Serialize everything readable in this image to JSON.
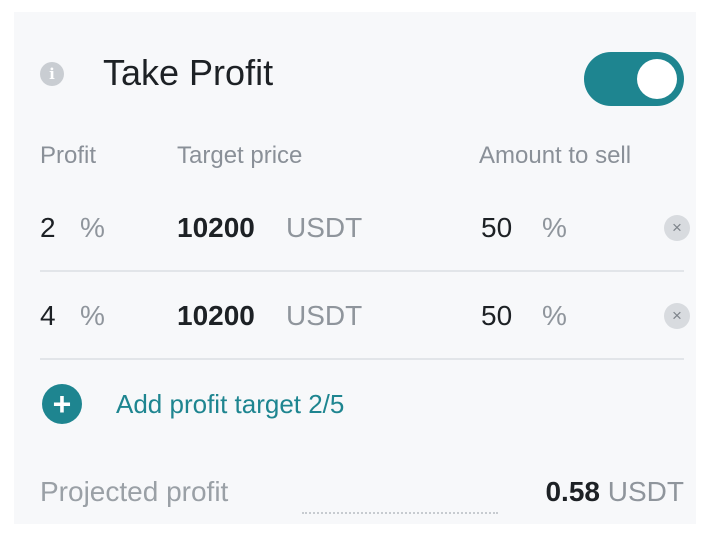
{
  "header": {
    "info_icon": "i",
    "title": "Take Profit",
    "toggle_on": true,
    "accent_color": "#1e8590"
  },
  "columns": {
    "profit": "Profit",
    "target_price": "Target price",
    "amount": "Amount to sell"
  },
  "targets": [
    {
      "profit": "2",
      "profit_unit": "%",
      "price": "10200",
      "price_unit": "USDT",
      "amount": "50",
      "amount_unit": "%",
      "remove": "×"
    },
    {
      "profit": "4",
      "profit_unit": "%",
      "price": "10200",
      "price_unit": "USDT",
      "amount": "50",
      "amount_unit": "%",
      "remove": "×"
    }
  ],
  "add_target": {
    "icon": "+",
    "label": "Add profit target 2/5"
  },
  "projected": {
    "label": "Projected profit",
    "value": "0.58",
    "currency": "USDT"
  }
}
